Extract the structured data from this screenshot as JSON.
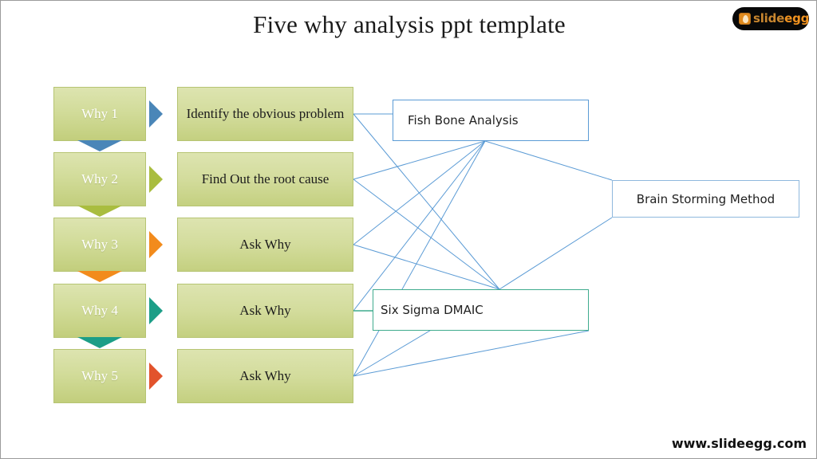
{
  "slide": {
    "title": "Five why analysis ppt template",
    "footer_url": "www.slideegg.com",
    "background": "#ffffff",
    "border_color": "#9b9b9b"
  },
  "logo": {
    "mark_name": "egg-icon",
    "text_primary": "slide",
    "text_accent": "egg",
    "background": "#080808",
    "primary_color": "#c8862f",
    "accent_color": "#f0921f"
  },
  "steps": [
    {
      "label": "Why 1",
      "description": "Identify the obvious problem",
      "arrow_color": "#4a86b8",
      "tail_color": "#4a86b8"
    },
    {
      "label": "Why 2",
      "description": "Find Out the root cause",
      "arrow_color": "#a9bd3f",
      "tail_color": "#a9bd3f"
    },
    {
      "label": "Why 3",
      "description": "Ask Why",
      "arrow_color": "#f28b1c",
      "tail_color": "#f28b1c"
    },
    {
      "label": "Why 4",
      "description": "Ask Why",
      "arrow_color": "#1c9e87",
      "tail_color": "#1c9e87"
    },
    {
      "label": "Why 5",
      "description": "Ask Why",
      "arrow_color": "#e2532c",
      "tail_color": "#e2532c"
    }
  ],
  "methods": [
    {
      "label": "Fish Bone Analysis",
      "border_color": "#5b9bd5"
    },
    {
      "label": "Brain Storming Method",
      "border_color": "#8fb8dd"
    },
    {
      "label": "Six Sigma DMAIC",
      "border_color": "#3fab8e"
    }
  ],
  "connector_style": {
    "color": "#5b9bd5",
    "accent_color": "#3fab8e",
    "width": 1
  }
}
